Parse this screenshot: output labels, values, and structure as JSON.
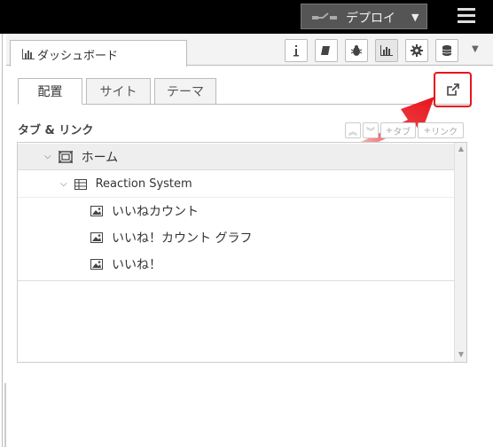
{
  "topbar": {
    "deploy_label": "デプロイ"
  },
  "panel": {
    "tab_label": "ダッシュボード"
  },
  "subtabs": [
    {
      "label": "配置"
    },
    {
      "label": "サイト"
    },
    {
      "label": "テーマ"
    }
  ],
  "section": {
    "title": "タブ & リンク",
    "add_tab_label": "タブ",
    "add_link_label": "リンク"
  },
  "tree": {
    "tab": {
      "label": "ホーム"
    },
    "group": {
      "label": "Reaction System"
    },
    "widgets": [
      {
        "label": "いいねカウント"
      },
      {
        "label": "いいね！カウント グラフ"
      },
      {
        "label": "いいね！"
      }
    ]
  },
  "colors": {
    "highlight": "#e8141b",
    "topbar": "#000000"
  }
}
